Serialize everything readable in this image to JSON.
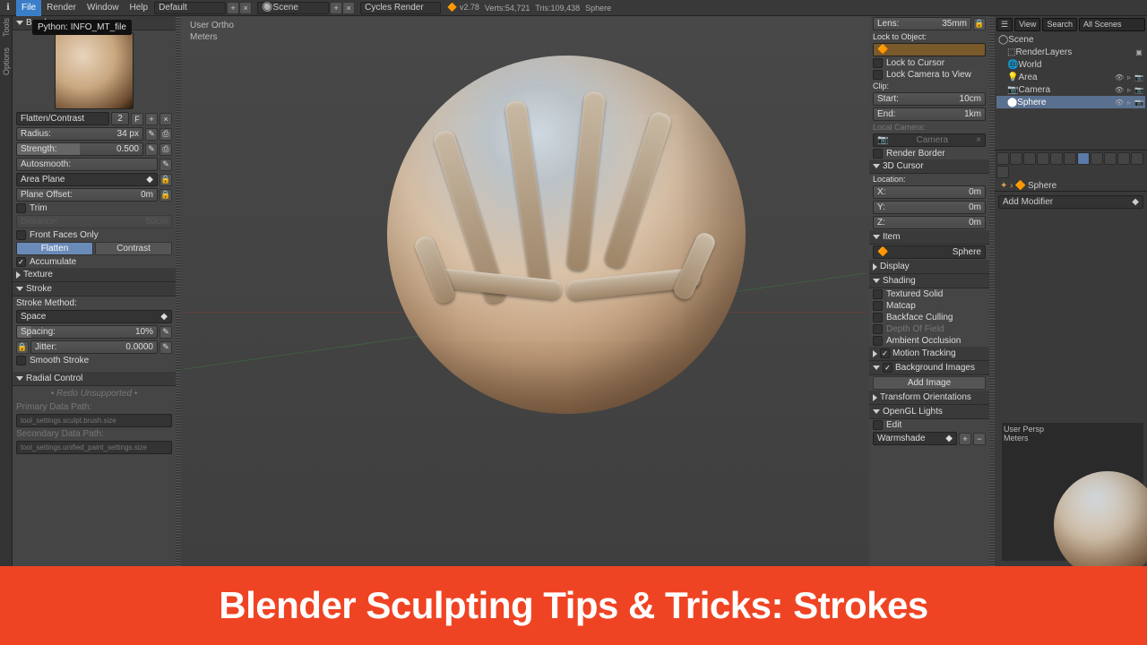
{
  "topbar": {
    "menus": [
      "File",
      "Render",
      "Window",
      "Help"
    ],
    "layout": "Default",
    "scene": "Scene",
    "engine": "Cycles Render",
    "version": "v2.78",
    "verts": "Verts:54,721",
    "tris": "Tris:109,438",
    "object": "Sphere"
  },
  "tooltip": "Python: INFO_MT_file",
  "left": {
    "brush_panel": "Brush",
    "brush_name": "Flatten/Contrast",
    "brush_num": "2",
    "radius_label": "Radius:",
    "radius_val": "34 px",
    "strength_label": "Strength:",
    "strength_val": "0.500",
    "autosmooth_label": "Autosmooth:",
    "plane": "Area Plane",
    "plane_offset_label": "Plane Offset:",
    "plane_offset_val": "0m",
    "trim": "Trim",
    "distance_label": "Distance:",
    "distance_val": "50cm",
    "front_faces": "Front Faces Only",
    "flatten": "Flatten",
    "contrast": "Contrast",
    "accumulate": "Accumulate",
    "texture": "Texture",
    "stroke": "Stroke",
    "stroke_method": "Stroke Method:",
    "stroke_method_val": "Space",
    "spacing_label": "Spacing:",
    "spacing_val": "10%",
    "jitter_label": "Jitter:",
    "jitter_val": "0.0000",
    "smooth_stroke": "Smooth Stroke",
    "radial": "Radial Control",
    "redo": "• Redo Unsupported •",
    "primary": "Primary Data Path:",
    "primary_val": "tool_settings.sculpt.brush.size",
    "secondary": "Secondary Data Path:",
    "secondary_val": "tool_settings.unified_paint_settings.size"
  },
  "view3d": {
    "view_label_1": "User Ortho",
    "view_label_2": "Meters"
  },
  "npanel": {
    "lens_label": "Lens:",
    "lens_val": "35mm",
    "lock_obj": "Lock to Object:",
    "lock_cursor": "Lock to Cursor",
    "lock_cam": "Lock Camera to View",
    "clip": "Clip:",
    "clip_start_label": "Start:",
    "clip_start_val": "10cm",
    "clip_end_label": "End:",
    "clip_end_val": "1km",
    "local_cam": "Local Camera:",
    "camera": "Camera",
    "render_border": "Render Border",
    "cursor3d": "3D Cursor",
    "loc": "Location:",
    "x": "X:",
    "y": "Y:",
    "z": "Z:",
    "zero": "0m",
    "item": "Item",
    "item_name": "Sphere",
    "display": "Display",
    "shading": "Shading",
    "tex_solid": "Textured Solid",
    "matcap": "Matcap",
    "backface": "Backface Culling",
    "dof": "Depth Of Field",
    "ao": "Ambient Occlusion",
    "motion": "Motion Tracking",
    "bg": "Background Images",
    "add_img": "Add Image",
    "transform": "Transform Orientations",
    "gl": "OpenGL Lights",
    "edit": "Edit",
    "warmshade": "Warmshade"
  },
  "outliner": {
    "hdr_view": "View",
    "hdr_search": "Search",
    "hdr_scenes": "All Scenes",
    "items": [
      "Scene",
      "RenderLayers",
      "World",
      "Area",
      "Camera",
      "Sphere"
    ]
  },
  "props": {
    "breadcrumb": "Sphere",
    "add_mod": "Add Modifier"
  },
  "preview": {
    "label1": "User Persp",
    "label2": "Meters"
  },
  "caption": "Blender Sculpting Tips & Tricks: Strokes"
}
